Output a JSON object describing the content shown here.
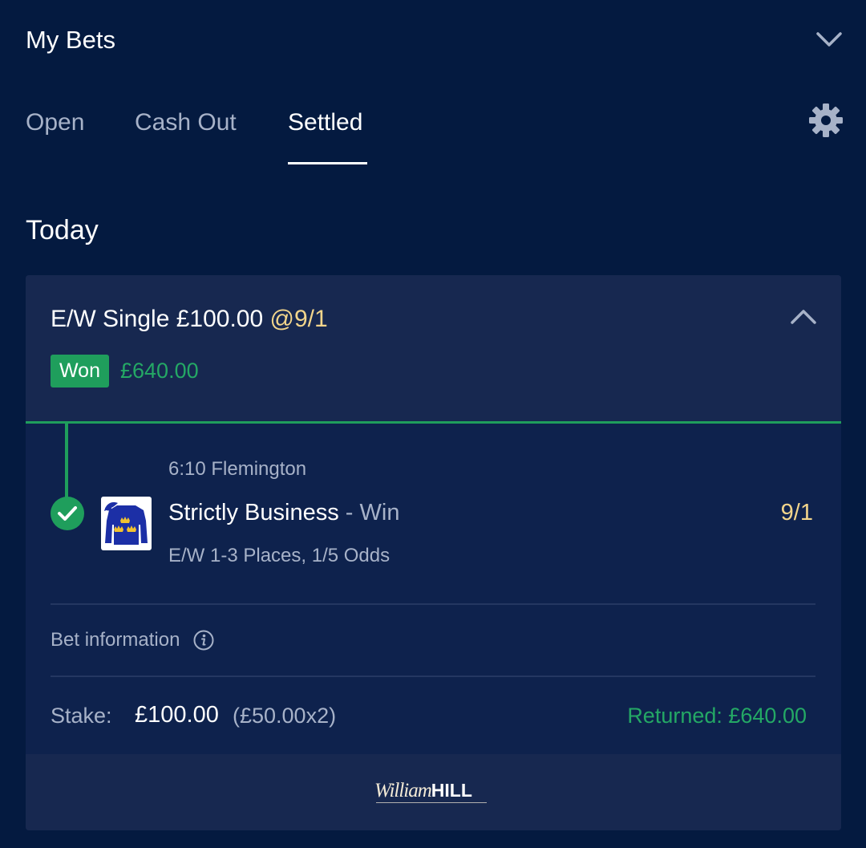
{
  "header": {
    "title": "My Bets"
  },
  "tabs": [
    {
      "label": "Open",
      "active": false
    },
    {
      "label": "Cash Out",
      "active": false
    },
    {
      "label": "Settled",
      "active": true
    }
  ],
  "section": {
    "title": "Today"
  },
  "bet": {
    "type_and_stake": "E/W Single £100.00",
    "odds": "@9/1",
    "status": "Won",
    "winnings": "£640.00",
    "selection": {
      "race": "6:10 Flemington",
      "name": "Strictly Business",
      "market": " - Win",
      "odds": "9/1",
      "terms": "E/W 1-3 Places, 1/5 Odds",
      "result": "won"
    },
    "info_label": "Bet information",
    "stake_label": "Stake:",
    "stake_value": "£100.00",
    "stake_breakdown": "(£50.00x2)",
    "returned": "Returned: £640.00"
  },
  "footer": {
    "brand_script": "William",
    "brand_bold": "HILL"
  },
  "colors": {
    "background": "#041a40",
    "card": "#0e224d",
    "card_header": "#172850",
    "win_green": "#1f9e5c",
    "odds_gold": "#f2d58b",
    "muted_text": "#a7b2c8"
  },
  "icons": {
    "collapse": "chevron-down-icon",
    "settings": "gear-icon",
    "card_collapse": "chevron-up-icon",
    "result": "check-circle-icon",
    "info": "info-icon",
    "silks": "jockey-silks-icon"
  }
}
